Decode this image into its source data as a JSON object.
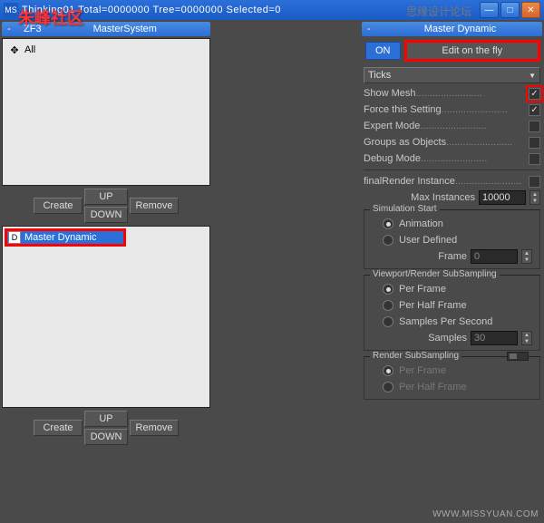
{
  "titlebar": {
    "icon": "MS",
    "text": "Thinking01  Total=0000000  Tree=0000000  Selected=0"
  },
  "watermarks": {
    "w1": "朱峰社区",
    "w2": "思缘设计论坛",
    "w3": "WWW.MISSYUAN.COM"
  },
  "left": {
    "section1_title": "MasterSystem",
    "zf_prefix": "ZF3",
    "list1_item": "All",
    "btn_create": "Create",
    "btn_up": "UP",
    "btn_down": "DOWN",
    "btn_remove": "Remove",
    "list2_item": "Master Dynamic"
  },
  "right": {
    "hdr": "Master Dynamic",
    "on": "ON",
    "edit": "Edit on the fly",
    "ticks": "Ticks",
    "show_mesh": "Show Mesh",
    "force_setting": "Force this Setting",
    "expert": "Expert Mode",
    "groups": "Groups as Objects",
    "debug": "Debug Mode",
    "final_render": "finalRender Instance",
    "max_inst": "Max Instances",
    "max_inst_val": "10000",
    "sim_start": "Simulation Start",
    "animation": "Animation",
    "user_def": "User Defined",
    "frame": "Frame",
    "frame_val": "0",
    "vr_sub": "Viewport/Render SubSampling",
    "per_frame": "Per Frame",
    "per_half": "Per Half Frame",
    "samples_per": "Samples Per Second",
    "samples": "Samples",
    "samples_val": "30",
    "render_sub": "Render SubSampling",
    "r_per_frame": "Per Frame",
    "r_per_half": "Per Half Frame"
  }
}
